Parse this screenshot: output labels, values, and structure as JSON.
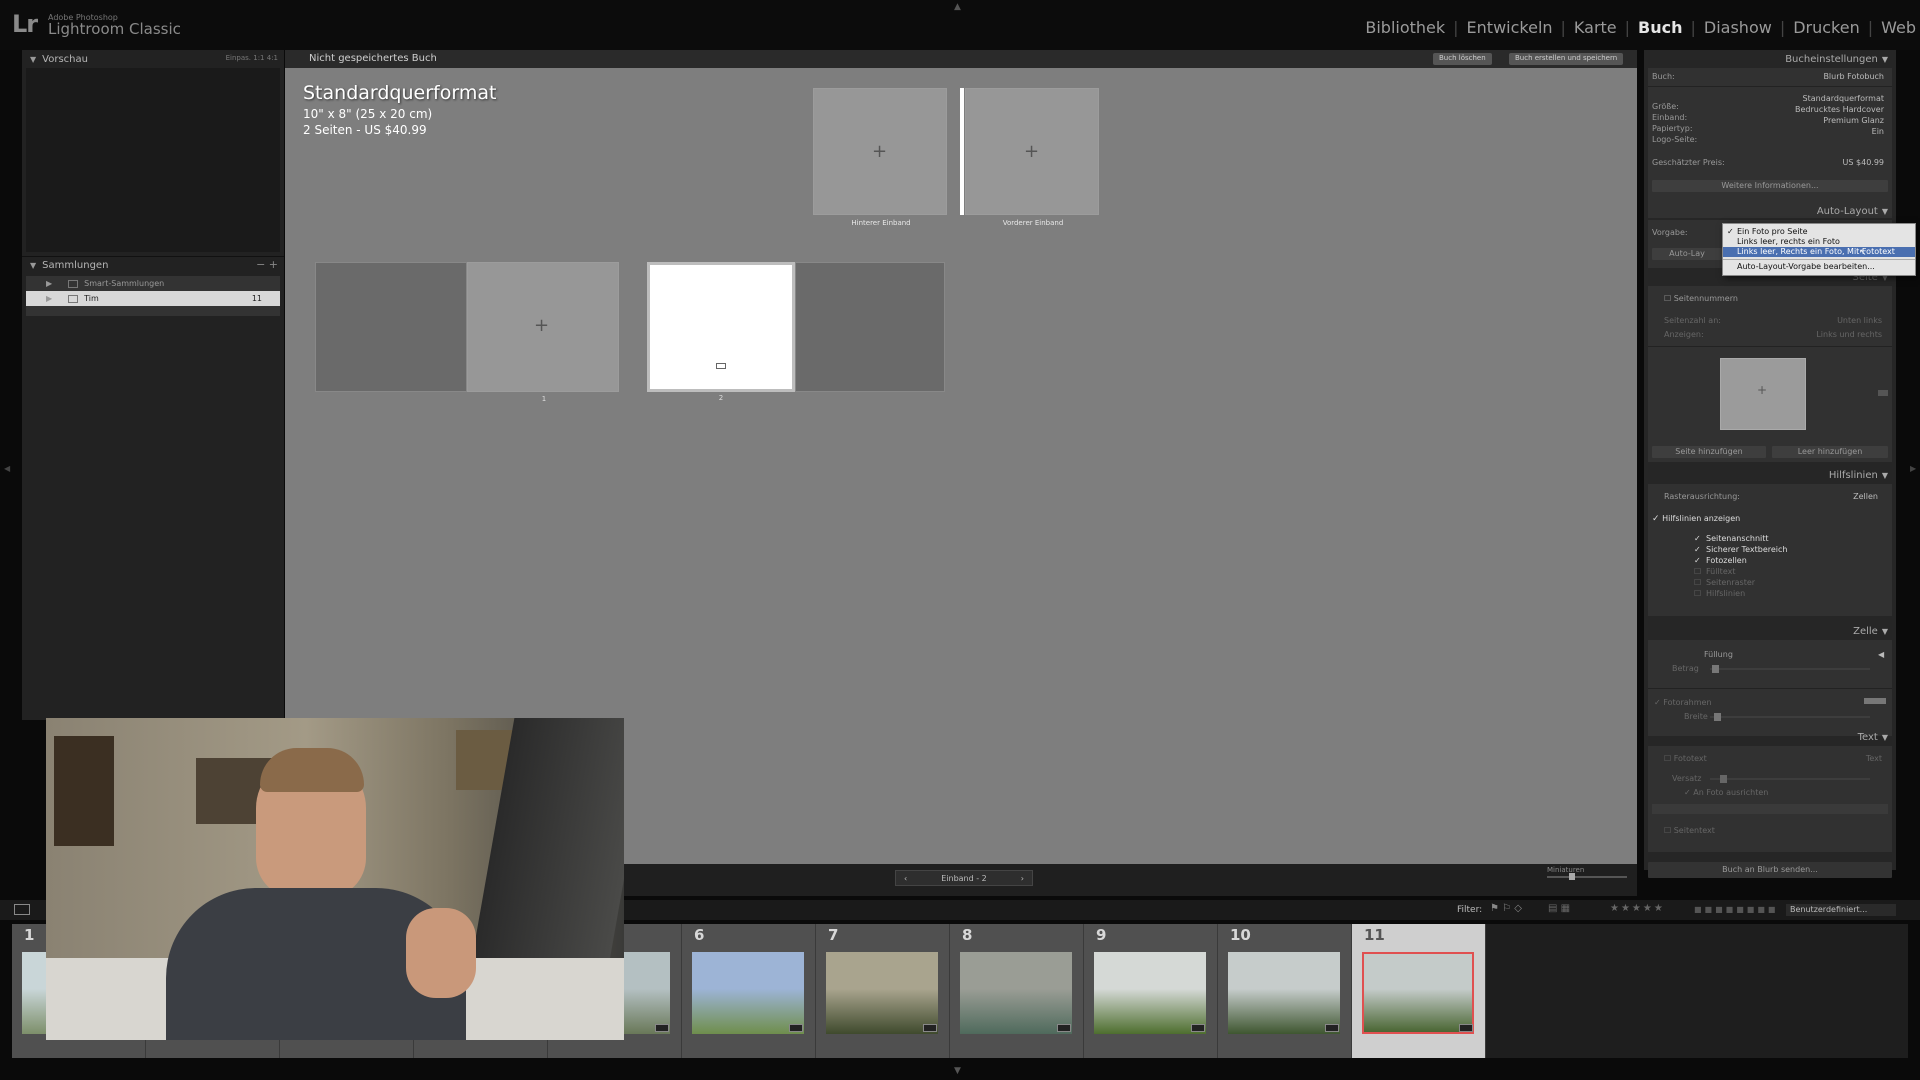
{
  "app": {
    "brand_small": "Adobe Photoshop",
    "brand_name": "Lightroom Classic",
    "logo": "Lr"
  },
  "modules": [
    "Bibliothek",
    "Entwickeln",
    "Karte",
    "Buch",
    "Diashow",
    "Drucken",
    "Web"
  ],
  "active_module": "Buch",
  "left_panel": {
    "preview_title": "Vorschau",
    "preview_opts": "Einpas.   1:1   4:1",
    "collections_title": "Sammlungen",
    "collections_controls": "−  +",
    "collections": [
      {
        "label": "Smart-Sammlungen",
        "count": ""
      },
      {
        "label": "Tim",
        "count": "11"
      }
    ]
  },
  "center": {
    "book_name": "Nicht gespeichertes Buch",
    "btn_delete": "Buch löschen",
    "btn_create": "Buch erstellen und speichern",
    "format_title": "Standardquerformat",
    "format_size": "10\" x 8\" (25 x 20 cm)",
    "format_pages": "2 Seiten - US $40.99",
    "cover_back_label": "Hinterer Einband",
    "cover_front_label": "Vorderer Einband",
    "page1_label": "1",
    "page2_label": "2",
    "nav_label": "Einband - 2",
    "nav_prev": "‹",
    "nav_next": "›",
    "mini_label": "Miniaturen"
  },
  "right_panel": {
    "book_settings_title": "Bucheinstellungen",
    "book_label": "Buch:",
    "book_value": "Blurb Fotobuch",
    "settings": [
      {
        "label": "Größe:",
        "value": "Standardquerformat"
      },
      {
        "label": "Einband:",
        "value": "Bedrucktes Hardcover"
      },
      {
        "label": "Papiertyp:",
        "value": "Premium Glanz"
      },
      {
        "label": "Logo-Seite:",
        "value": "Ein"
      }
    ],
    "price_label": "Geschätzter Preis:",
    "price_value": "US $40.99",
    "more_info": "Weitere Informationen...",
    "auto_layout_title": "Auto-Layout",
    "preset_label": "Vorgabe:",
    "auto_layout_btn": "Auto-Lay",
    "page_title": "Seite",
    "page_numbers": "Seitennummern",
    "page_pos_label": "Seitenzahl an:",
    "page_pos_value": "Unten links",
    "page_display_label": "Anzeigen:",
    "page_display_value": "Links und rechts",
    "add_page": "Seite hinzufügen",
    "add_blank": "Leer hinzufügen",
    "guides_title": "Hilfslinien",
    "grid_label": "Rasterausrichtung:",
    "grid_value": "Zellen",
    "show_guides": "Hilfslinien anzeigen",
    "guides": [
      {
        "label": "Seitenanschnitt",
        "checked": true
      },
      {
        "label": "Sicherer Textbereich",
        "checked": true
      },
      {
        "label": "Fotozellen",
        "checked": true
      },
      {
        "label": "Fülltext",
        "checked": false
      },
      {
        "label": "Seitenraster",
        "checked": false
      },
      {
        "label": "Hilfslinien",
        "checked": false
      }
    ],
    "cell_title": "Zelle",
    "padding_label": "Füllung",
    "amount_label": "Betrag",
    "photo_border_label": "Fotorahmen",
    "width_label": "Breite",
    "text_title": "Text",
    "photo_text_label": "Fototext",
    "photo_text_value": "Text",
    "offset_label": "Versatz",
    "align_label": "An Foto ausrichten",
    "page_text_label": "Seitentext",
    "send_blurb": "Buch an Blurb senden..."
  },
  "dropdown": {
    "items": [
      {
        "label": "Ein Foto pro Seite",
        "checked": true,
        "highlighted": false
      },
      {
        "label": "Links leer, rechts ein Foto",
        "checked": false,
        "highlighted": false
      },
      {
        "label": "Links leer, Rechts ein Foto, Mit Fototext",
        "checked": false,
        "highlighted": true
      }
    ],
    "edit_item": "Auto-Layout-Vorgabe bearbeiten..."
  },
  "filterbar": {
    "filter_label": "Filter:",
    "stars": "★★★★★",
    "preset": "Benutzerdefiniert..."
  },
  "filmstrip": {
    "cells": [
      {
        "num": "1",
        "colors": [
          "#c9d6d8",
          "#7d8f6a"
        ]
      },
      {
        "num": "",
        "colors": [
          "#b9c5c7",
          "#6f7f5e"
        ]
      },
      {
        "num": "",
        "colors": [
          "#aab6b8",
          "#6b7a5a"
        ]
      },
      {
        "num": "",
        "colors": [
          "#c0cbcd",
          "#738262"
        ]
      },
      {
        "num": "",
        "colors": [
          "#b4c0c2",
          "#697858"
        ]
      },
      {
        "num": "6",
        "colors": [
          "#9db4d6",
          "#6f8e4c"
        ]
      },
      {
        "num": "7",
        "colors": [
          "#a9a48e",
          "#3f4a2d"
        ]
      },
      {
        "num": "8",
        "colors": [
          "#9a9d95",
          "#4f6a5c"
        ]
      },
      {
        "num": "9",
        "colors": [
          "#d5d9d6",
          "#4d6e2e"
        ]
      },
      {
        "num": "10",
        "colors": [
          "#c6cccb",
          "#3e5630"
        ]
      },
      {
        "num": "11",
        "colors": [
          "#c4cbc9",
          "#4a6633"
        ]
      }
    ],
    "selected_index": 10
  }
}
